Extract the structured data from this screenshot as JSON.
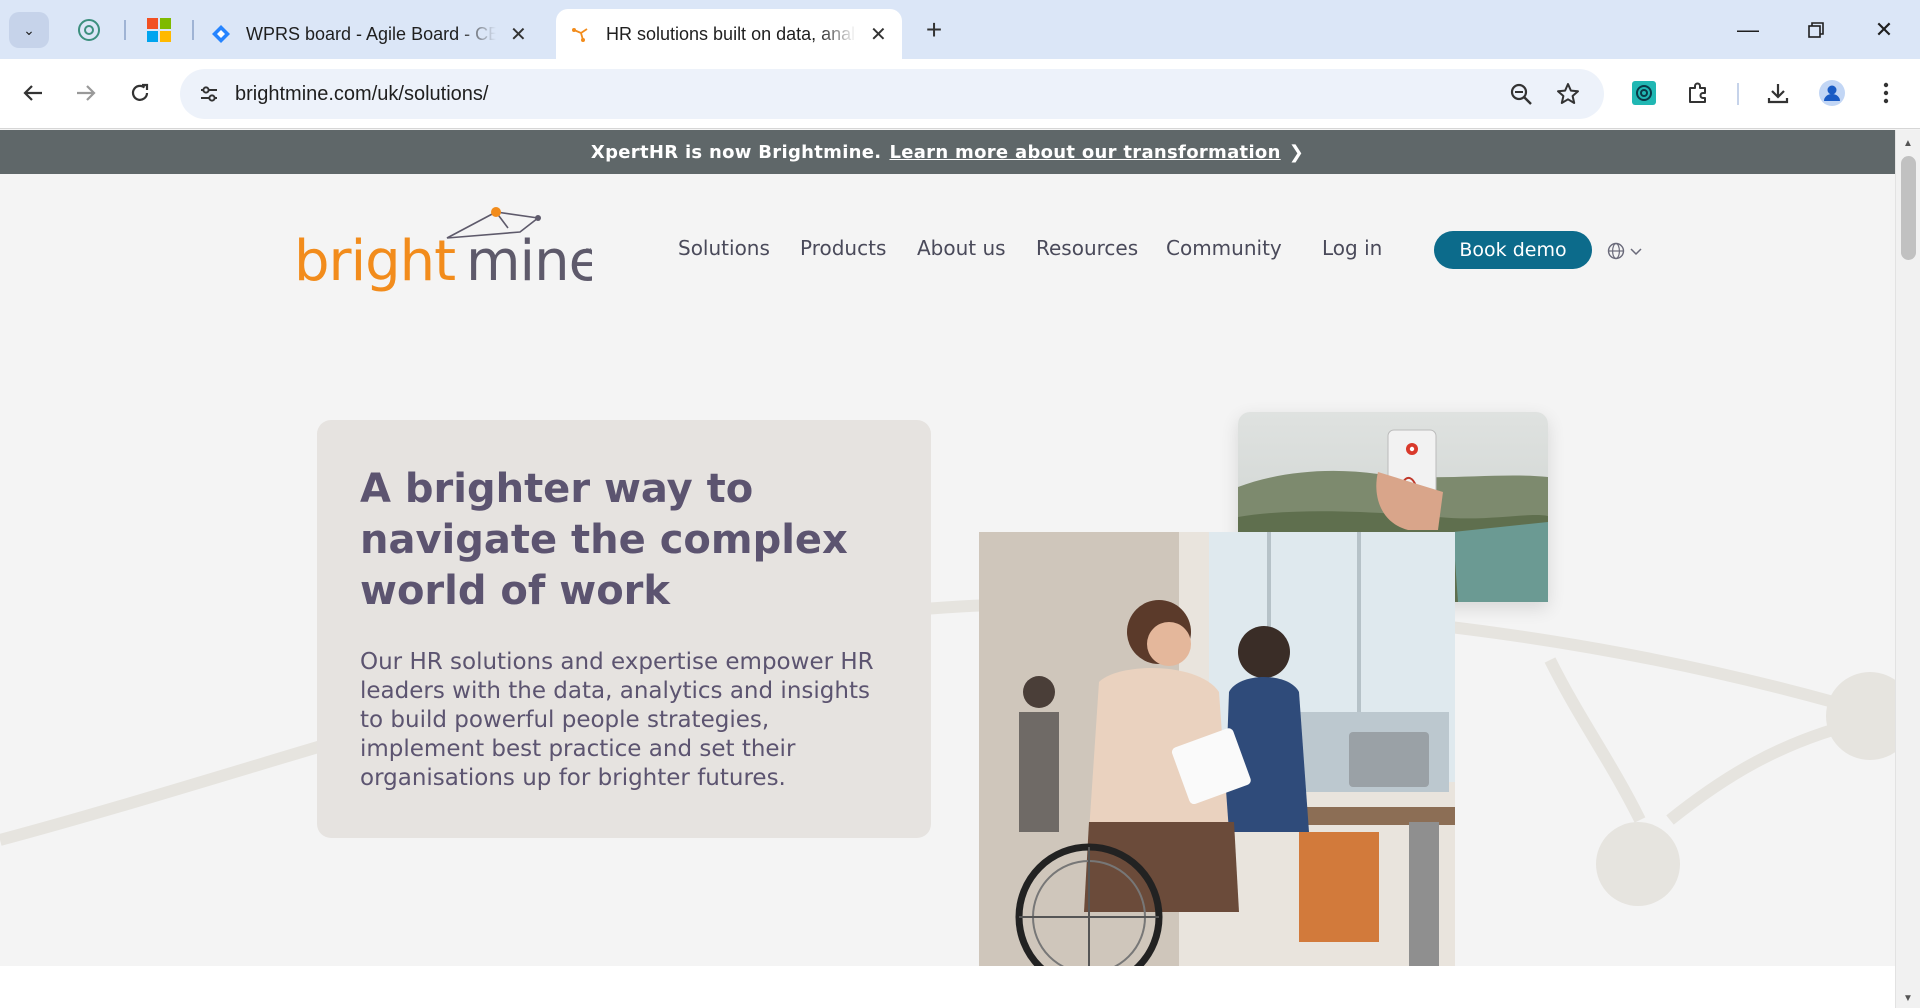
{
  "browser": {
    "tabs": [
      {
        "title": "WPRS board - Agile Board - CEL",
        "active": false
      },
      {
        "title": "HR solutions built on data, analytics",
        "active": true
      }
    ],
    "url": "brightmine.com/uk/solutions/"
  },
  "banner": {
    "text": "XpertHR is now Brightmine.",
    "link": "Learn more about our transformation",
    "chevron": "❯"
  },
  "brand": {
    "logo_text_1": "bright",
    "logo_text_2": "mine",
    "trademark": "™",
    "orange": "#f28c1c",
    "gray": "#5e5a6b",
    "teal": "#0c6b8b"
  },
  "nav": {
    "items": [
      "Solutions",
      "Products",
      "About us",
      "Resources",
      "Community"
    ],
    "login": "Log in",
    "cta": "Book demo"
  },
  "hero": {
    "title": "A brighter way to navigate the complex world of work",
    "body": "Our HR solutions and expertise empower HR leaders with the data, analytics and insights to build powerful people strategies, implement best practice and set their organisations up for brighter futures."
  }
}
